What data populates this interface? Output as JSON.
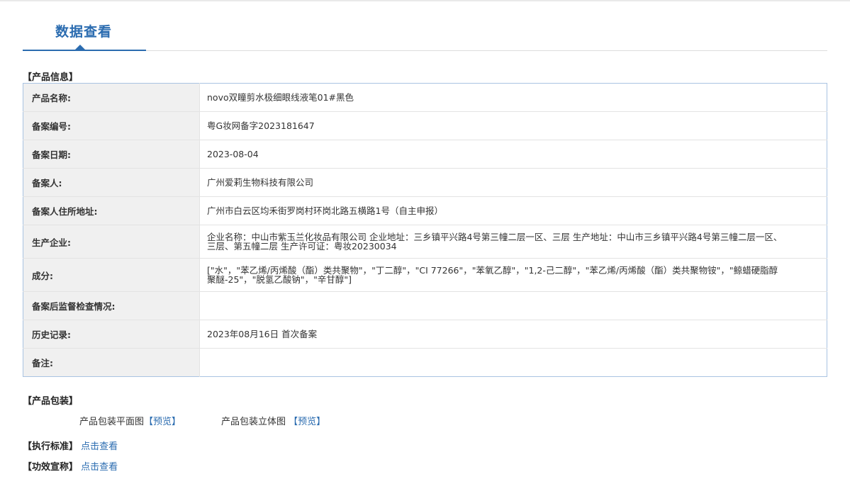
{
  "tab": {
    "title": "数据查看"
  },
  "product_info": {
    "section_title": "【产品信息】",
    "rows": [
      {
        "label": "产品名称:",
        "value": "novo双瞳剪水极细眼线液笔01#黑色"
      },
      {
        "label": "备案编号:",
        "value": "粤G妆网备字2023181647"
      },
      {
        "label": "备案日期:",
        "value": "2023-08-04"
      },
      {
        "label": "备案人:",
        "value": "广州爱莉生物科技有限公司"
      },
      {
        "label": "备案人住所地址:",
        "value": "广州市白云区均禾街罗岗村环岗北路五横路1号（自主申报）"
      },
      {
        "label": "生产企业:",
        "value": "企业名称：中山市紫玉兰化妆品有限公司 企业地址：三乡镇平兴路4号第三幢二层一区、三层 生产地址：中山市三乡镇平兴路4号第三幢二层一区、三层、第五幢二层 生产许可证：粤妆20230034"
      },
      {
        "label": "成分:",
        "value": "[\"水\"，\"苯乙烯/丙烯酸（酯）类共聚物\"，\"丁二醇\"，\"CI 77266\"，\"苯氧乙醇\"，\"1,2-己二醇\"，\"苯乙烯/丙烯酸（酯）类共聚物铵\"，\"鲸蜡硬脂醇聚醚-25\"，\"脱氢乙酸钠\"，\"辛甘醇\"]"
      },
      {
        "label": "备案后监督检查情况:",
        "value": ""
      },
      {
        "label": "历史记录:",
        "value": "2023年08月16日 首次备案"
      },
      {
        "label": "备注:",
        "value": ""
      }
    ]
  },
  "packaging": {
    "section_title": "【产品包装】",
    "flat_label": "产品包装平面图",
    "flat_link": "【预览】",
    "solid_label": "产品包装立体图",
    "solid_link": "【预览】"
  },
  "standard": {
    "label": "【执行标准】",
    "link": "点击查看"
  },
  "efficacy": {
    "label": "【功效宣称】",
    "link": "点击查看"
  }
}
